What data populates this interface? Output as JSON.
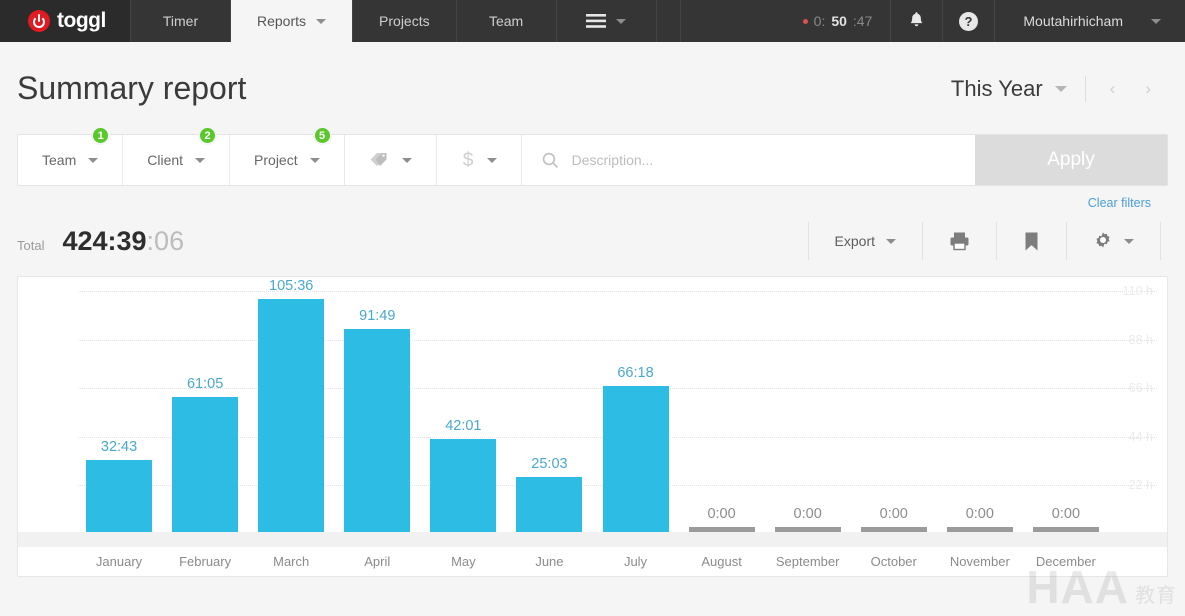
{
  "navbar": {
    "brand": "toggl",
    "items": [
      {
        "label": "Timer",
        "has_caret": false,
        "active": false
      },
      {
        "label": "Reports",
        "has_caret": true,
        "active": true
      },
      {
        "label": "Projects",
        "has_caret": false,
        "active": false
      },
      {
        "label": "Team",
        "has_caret": false,
        "active": false
      }
    ],
    "menu_icon": "hamburger-icon",
    "timer": {
      "prefix": "0:",
      "minutes": "50",
      "seconds": ":47",
      "full": "0:50:47"
    },
    "bell_icon": "bell-icon",
    "help_icon": "help-circle-icon",
    "user": "Moutahirhicham"
  },
  "header": {
    "title": "Summary report",
    "date_range": "This Year",
    "prev_label": "‹",
    "next_label": "›"
  },
  "filters": {
    "team": {
      "label": "Team",
      "badge": "1"
    },
    "client": {
      "label": "Client",
      "badge": "2"
    },
    "project": {
      "label": "Project",
      "badge": "5"
    },
    "tag_icon": "tag-icon",
    "billable_icon": "dollar-icon",
    "search_placeholder": "Description...",
    "search_value": "",
    "search_icon": "search-icon",
    "apply_label": "Apply",
    "clear_label": "Clear filters"
  },
  "total": {
    "label": "Total",
    "hours_minutes": "424:39",
    "seconds": ":06"
  },
  "toolbar": {
    "export_label": "Export",
    "print_icon": "printer-icon",
    "bookmark_icon": "bookmark-icon",
    "settings_icon": "gear-icon"
  },
  "chart_data": {
    "type": "bar",
    "title": "",
    "xlabel": "",
    "ylabel": "hours",
    "categories": [
      "January",
      "February",
      "March",
      "April",
      "May",
      "June",
      "July",
      "August",
      "September",
      "October",
      "November",
      "December"
    ],
    "values": [
      32.72,
      61.08,
      105.6,
      91.82,
      42.02,
      25.05,
      66.3,
      0,
      0,
      0,
      0,
      0
    ],
    "value_labels": [
      "32:43",
      "61:05",
      "105:36",
      "91:49",
      "42:01",
      "25:03",
      "66:18",
      "0:00",
      "0:00",
      "0:00",
      "0:00",
      "0:00"
    ],
    "ylim": [
      0,
      110
    ],
    "yticks": [
      22,
      44,
      66,
      88,
      110
    ],
    "ytick_labels": [
      "22 h",
      "44 h",
      "66 h",
      "88 h",
      "110 h"
    ],
    "grid": true,
    "legend": "none",
    "bar_color": "#2dbde4",
    "empty_bar_color": "#9b9b9b",
    "label_color": "#4aa8cd"
  },
  "watermark": {
    "main": "HAA",
    "sub": "教育"
  }
}
